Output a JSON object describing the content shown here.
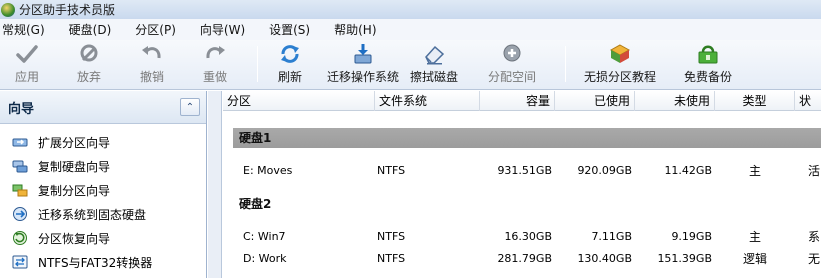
{
  "window": {
    "title": "分区助手技术员版"
  },
  "menu": [
    "常规(G)",
    "硬盘(D)",
    "分区(P)",
    "向导(W)",
    "设置(S)",
    "帮助(H)"
  ],
  "toolbar": {
    "apply": "应用",
    "discard": "放弃",
    "undo": "撤销",
    "redo": "重做",
    "refresh": "刷新",
    "migrate_os": "迁移操作系统",
    "wipe_disk": "擦拭磁盘",
    "allocate_space": "分配空间",
    "lossless_tutorial": "无损分区教程",
    "free_backup": "免费备份"
  },
  "sidebar": {
    "title": "向导",
    "items": [
      {
        "label": "扩展分区向导",
        "icon": "extend-partition-icon"
      },
      {
        "label": "复制硬盘向导",
        "icon": "copy-disk-icon"
      },
      {
        "label": "复制分区向导",
        "icon": "copy-partition-icon"
      },
      {
        "label": "迁移系统到固态硬盘",
        "icon": "migrate-ssd-icon"
      },
      {
        "label": "分区恢复向导",
        "icon": "partition-recovery-icon"
      },
      {
        "label": "NTFS与FAT32转换器",
        "icon": "ntfs-fat32-converter-icon"
      }
    ]
  },
  "table": {
    "columns": [
      "分区",
      "文件系统",
      "容量",
      "已使用",
      "未使用",
      "类型",
      "状"
    ],
    "disk1": {
      "label": "硬盘1",
      "rows": [
        {
          "partition": "E: Moves",
          "fs": "NTFS",
          "capacity": "931.51GB",
          "used": "920.09GB",
          "free": "11.42GB",
          "type": "主",
          "status": "活"
        }
      ]
    },
    "disk2": {
      "label": "硬盘2",
      "rows": [
        {
          "partition": "C: Win7",
          "fs": "NTFS",
          "capacity": "16.30GB",
          "used": "7.11GB",
          "free": "9.19GB",
          "type": "主",
          "status": "系"
        },
        {
          "partition": "D: Work",
          "fs": "NTFS",
          "capacity": "281.79GB",
          "used": "130.40GB",
          "free": "151.39GB",
          "type": "逻辑",
          "status": "无"
        }
      ]
    }
  }
}
